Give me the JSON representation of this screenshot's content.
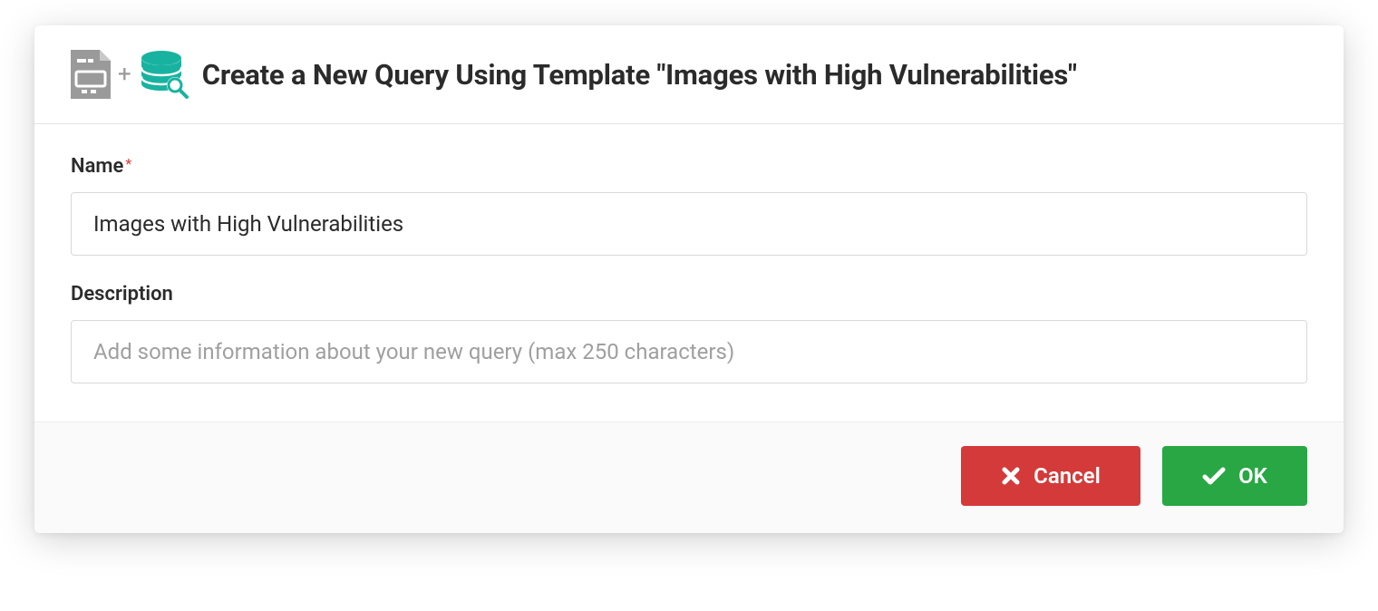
{
  "colors": {
    "accent_teal": "#18b3a0",
    "icon_gray": "#9a9a9a",
    "danger": "#d43a3a",
    "success": "#29a744"
  },
  "header": {
    "title": "Create a New Query Using Template \"Images with High Vulnerabilities\"",
    "icons": {
      "left": "template-file-icon",
      "plus": "+",
      "right": "database-search-icon"
    }
  },
  "form": {
    "name": {
      "label": "Name",
      "required_marker": "*",
      "value": "Images with High Vulnerabilities"
    },
    "description": {
      "label": "Description",
      "placeholder": "Add some information about your new query (max 250 characters)",
      "value": ""
    }
  },
  "footer": {
    "cancel_label": "Cancel",
    "ok_label": "OK"
  }
}
